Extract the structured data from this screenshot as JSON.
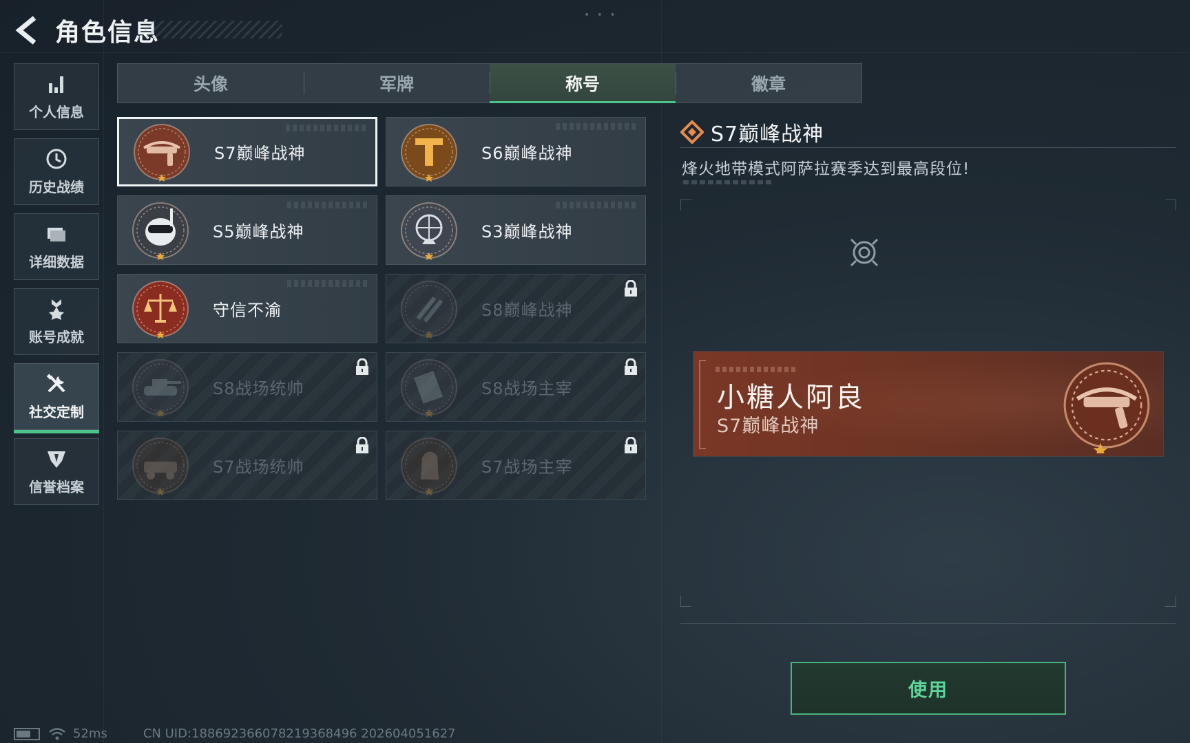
{
  "header": {
    "title": "角色信息"
  },
  "sidebar": {
    "items": [
      {
        "label": "个人信息",
        "icon": "bar-chart-icon",
        "active": false
      },
      {
        "label": "历史战绩",
        "icon": "history-icon",
        "active": false
      },
      {
        "label": "详细数据",
        "icon": "folder-icon",
        "active": false
      },
      {
        "label": "账号成就",
        "icon": "medal-icon",
        "active": false
      },
      {
        "label": "社交定制",
        "icon": "tools-icon",
        "active": true
      },
      {
        "label": "信誉档案",
        "icon": "shield-icon",
        "active": false
      }
    ]
  },
  "tabs": [
    {
      "label": "头像",
      "active": false
    },
    {
      "label": "军牌",
      "active": false
    },
    {
      "label": "称号",
      "active": true
    },
    {
      "label": "徽章",
      "active": false
    }
  ],
  "titles": [
    {
      "name": "S7巅峰战神",
      "icon": "crossbow-badge-icon",
      "locked": false,
      "selected": true,
      "color": "#7a3a27"
    },
    {
      "name": "S6巅峰战神",
      "icon": "t-emblem-badge-icon",
      "locked": false,
      "selected": false,
      "color": "#7a4a1a"
    },
    {
      "name": "S5巅峰战神",
      "icon": "skull-diver-badge-icon",
      "locked": false,
      "selected": false,
      "color": "#3a3f46"
    },
    {
      "name": "S3巅峰战神",
      "icon": "globe-badge-icon",
      "locked": false,
      "selected": false,
      "color": "#3f4650"
    },
    {
      "name": "守信不渝",
      "icon": "scales-badge-icon",
      "locked": false,
      "selected": false,
      "color": "#8a2c1f"
    },
    {
      "name": "S8巅峰战神",
      "icon": "slash-badge-icon",
      "locked": true,
      "selected": false,
      "color": "#3a4048"
    },
    {
      "name": "S8战场统帅",
      "icon": "tank-badge-icon",
      "locked": true,
      "selected": false,
      "color": "#3a4048"
    },
    {
      "name": "S8战场主宰",
      "icon": "building-badge-icon",
      "locked": true,
      "selected": false,
      "color": "#3a4048"
    },
    {
      "name": "S7战场统帅",
      "icon": "vehicle-badge-icon",
      "locked": true,
      "selected": false,
      "color": "#4a3a30"
    },
    {
      "name": "S7战场主宰",
      "icon": "soldier-badge-icon",
      "locked": true,
      "selected": false,
      "color": "#4a3a30"
    }
  ],
  "detail": {
    "title": "S7巅峰战神",
    "description": "烽火地带模式阿萨拉赛季达到最高段位!",
    "nameplate": {
      "player_name": "小糖人阿良",
      "player_title": "S7巅峰战神"
    },
    "use_label": "使用"
  },
  "status": {
    "ping": "52ms",
    "uid": "CN UID:188692366078219368496 202604051627"
  },
  "colors": {
    "accent": "#4cc489",
    "nameplate": "#7a3726",
    "star": "#e9a93a"
  }
}
